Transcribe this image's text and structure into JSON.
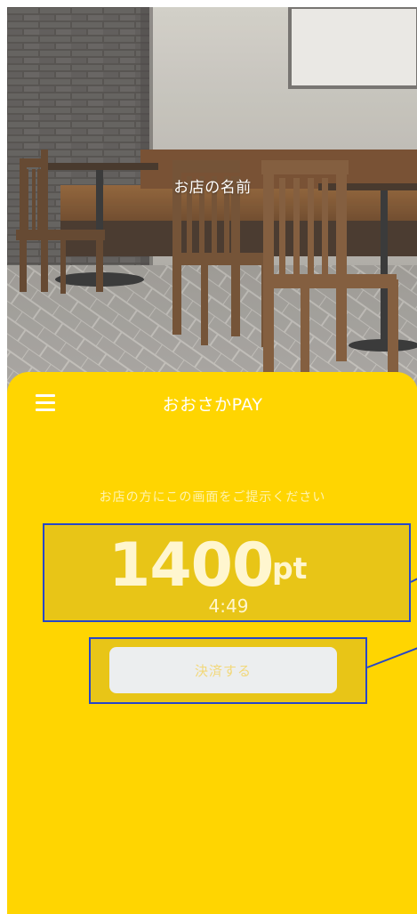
{
  "shop": {
    "name": "お店の名前"
  },
  "header": {
    "app_title": "おおさかPAY",
    "menu_icon": "hamburger-menu-icon"
  },
  "payment": {
    "instruction": "お店の方にこの画面をご提示ください",
    "points": "1400",
    "unit": "pt",
    "timer": "4:49",
    "pay_button_label": "決済する"
  },
  "colors": {
    "accent_yellow": "#ffd501",
    "highlight_box_fill": "#e8c517",
    "annotation_border": "#2747c8",
    "button_background": "#eceeef",
    "text_light": "#ffffff"
  }
}
